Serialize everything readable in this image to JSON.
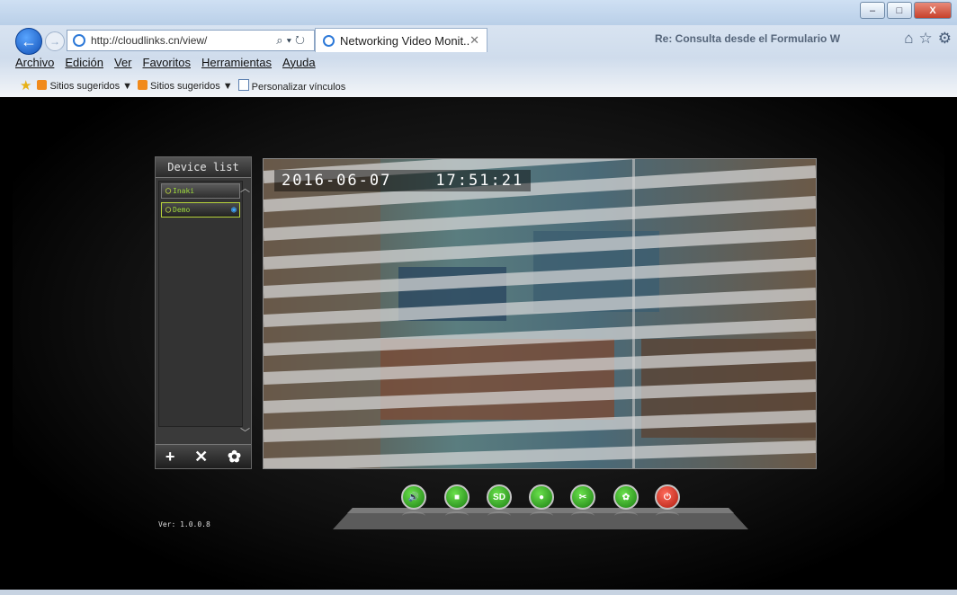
{
  "browser": {
    "address_url": "http://cloudlinks.cn/view/",
    "tab_title": "Networking Video Monit...",
    "other_tab_title": "Re: Consulta desde el Formulario W",
    "window_buttons": [
      "–",
      "□",
      "X"
    ]
  },
  "menu": [
    "Archivo",
    "Edición",
    "Ver",
    "Favoritos",
    "Herramientas",
    "Ayuda"
  ],
  "favorites_bar": {
    "items": [
      "Sitios sugeridos ▼",
      "Sitios sugeridos ▼",
      "Personalizar vínculos"
    ]
  },
  "app": {
    "device_list_title": "Device list",
    "devices": [
      {
        "name": "Inaki",
        "selected": false
      },
      {
        "name": "Demo",
        "selected": true
      }
    ],
    "toolbar": {
      "add": "+",
      "delete": "✕",
      "settings": "✿"
    },
    "osd_date": "2016-06-07",
    "osd_time": "17:51:21",
    "controls": [
      {
        "name": "speaker",
        "label": "🔊",
        "color": "#2fae1f"
      },
      {
        "name": "stop",
        "label": "■",
        "color": "#2fae1f"
      },
      {
        "name": "sd",
        "label": "SD",
        "color": "#2fae1f"
      },
      {
        "name": "record",
        "label": "●",
        "color": "#2fae1f"
      },
      {
        "name": "snapshot",
        "label": "✂",
        "color": "#2fae1f"
      },
      {
        "name": "settings",
        "label": "✿",
        "color": "#2fae1f"
      },
      {
        "name": "power",
        "label": "⏻",
        "color": "#d93323"
      }
    ],
    "version": "Ver: 1.0.0.8"
  }
}
